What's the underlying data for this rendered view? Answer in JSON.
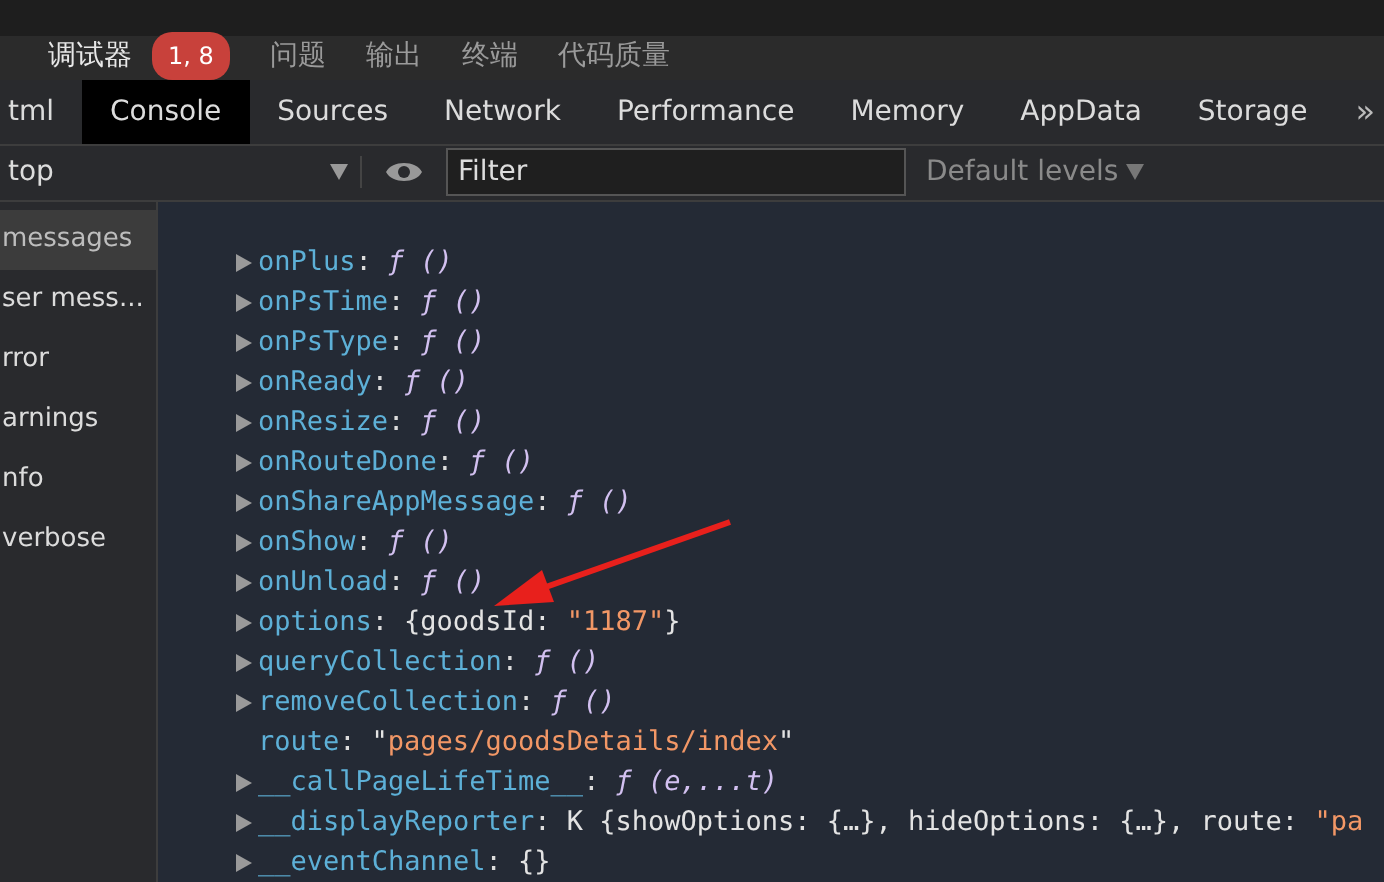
{
  "panel_tabs": [
    {
      "label": "调试器",
      "selected": true,
      "badge": "1, 8"
    },
    {
      "label": "问题",
      "selected": false
    },
    {
      "label": "输出",
      "selected": false
    },
    {
      "label": "终端",
      "selected": false
    },
    {
      "label": "代码质量",
      "selected": false
    }
  ],
  "devtools_tabs": [
    {
      "label": "tml",
      "selected": false
    },
    {
      "label": "Console",
      "selected": true
    },
    {
      "label": "Sources",
      "selected": false
    },
    {
      "label": "Network",
      "selected": false
    },
    {
      "label": "Performance",
      "selected": false
    },
    {
      "label": "Memory",
      "selected": false
    },
    {
      "label": "AppData",
      "selected": false
    },
    {
      "label": "Storage",
      "selected": false
    }
  ],
  "more_tabs": "»",
  "key_separator": ":",
  "toolbar": {
    "context": "top",
    "filter": {
      "placeholder": "Filter"
    },
    "levels": "Default levels"
  },
  "sidebar": [
    {
      "label": "messages",
      "selected": true
    },
    {
      "label": "ser mess...",
      "selected": false
    },
    {
      "label": "rror",
      "selected": false
    },
    {
      "label": "arnings",
      "selected": false
    },
    {
      "label": "nfo",
      "selected": false
    },
    {
      "label": "verbose",
      "selected": false
    }
  ],
  "console_rows": [
    {
      "key": "onPlus",
      "expandable": true,
      "value": [
        {
          "kind": "func",
          "text": "ƒ ()"
        }
      ]
    },
    {
      "key": "onPsTime",
      "expandable": true,
      "value": [
        {
          "kind": "func",
          "text": "ƒ ()"
        }
      ]
    },
    {
      "key": "onPsType",
      "expandable": true,
      "value": [
        {
          "kind": "func",
          "text": "ƒ ()"
        }
      ]
    },
    {
      "key": "onReady",
      "expandable": true,
      "value": [
        {
          "kind": "func",
          "text": "ƒ ()"
        }
      ]
    },
    {
      "key": "onResize",
      "expandable": true,
      "value": [
        {
          "kind": "func",
          "text": "ƒ ()"
        }
      ]
    },
    {
      "key": "onRouteDone",
      "expandable": true,
      "value": [
        {
          "kind": "func",
          "text": "ƒ ()"
        }
      ]
    },
    {
      "key": "onShareAppMessage",
      "expandable": true,
      "value": [
        {
          "kind": "func",
          "text": "ƒ ()"
        }
      ]
    },
    {
      "key": "onShow",
      "expandable": true,
      "value": [
        {
          "kind": "func",
          "text": "ƒ ()"
        }
      ]
    },
    {
      "key": "onUnload",
      "expandable": true,
      "value": [
        {
          "kind": "func",
          "text": "ƒ ()"
        }
      ]
    },
    {
      "key": "options",
      "expandable": true,
      "value": [
        {
          "kind": "plain",
          "text": "{goodsId: "
        },
        {
          "kind": "string",
          "text": "\"1187\""
        },
        {
          "kind": "plain",
          "text": "}"
        }
      ]
    },
    {
      "key": "queryCollection",
      "expandable": true,
      "value": [
        {
          "kind": "func",
          "text": "ƒ ()"
        }
      ]
    },
    {
      "key": "removeCollection",
      "expandable": true,
      "value": [
        {
          "kind": "func",
          "text": "ƒ ()"
        }
      ]
    },
    {
      "key": "route",
      "expandable": false,
      "value": [
        {
          "kind": "plain",
          "text": "\""
        },
        {
          "kind": "string",
          "text": "pages/goodsDetails/index"
        },
        {
          "kind": "plain",
          "text": "\""
        }
      ]
    },
    {
      "key": "__callPageLifeTime__",
      "expandable": true,
      "value": [
        {
          "kind": "func",
          "text": "ƒ (e,...t)"
        }
      ]
    },
    {
      "key": "__displayReporter",
      "expandable": true,
      "value": [
        {
          "kind": "plain",
          "text": "K {showOptions: {…}, hideOptions: {…}, route: "
        },
        {
          "kind": "string",
          "text": "\"pa"
        }
      ]
    },
    {
      "key": "__eventChannel",
      "expandable": true,
      "value": [
        {
          "kind": "plain",
          "text": "{}"
        }
      ]
    }
  ]
}
